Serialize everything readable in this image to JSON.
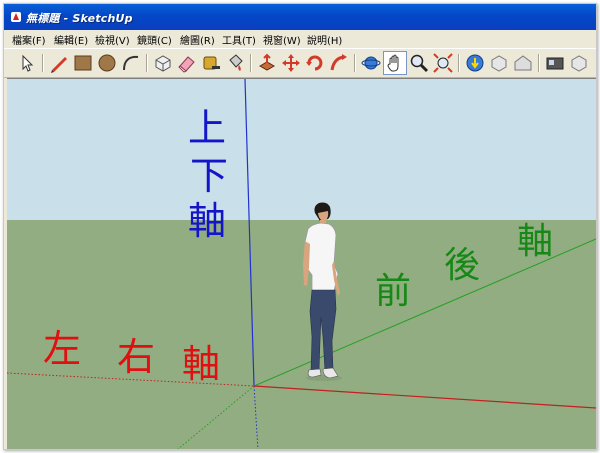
{
  "window": {
    "title": "無標題 - SketchUp"
  },
  "menu": {
    "items": [
      "檔案(F)",
      "編輯(E)",
      "檢視(V)",
      "鏡頭(C)",
      "繪圖(R)",
      "工具(T)",
      "視窗(W)",
      "說明(H)"
    ]
  },
  "toolbar": {
    "icons": [
      "select-icon",
      "pencil-icon",
      "rectangle-icon",
      "circle-icon",
      "arc-icon",
      "make-component-icon",
      "eraser-icon",
      "tape-measure-icon",
      "paint-bucket-icon",
      "push-pull-icon",
      "move-icon",
      "rotate-icon",
      "follow-me-icon",
      "orbit-icon",
      "pan-icon",
      "zoom-icon",
      "zoom-extents-icon",
      "get-models-icon",
      "share-model-icon",
      "warehouse-icon",
      "ruby-icon",
      "component-icon"
    ]
  },
  "viewport": {
    "sky_color": "#c9dfe9",
    "ground_color": "#93ad82",
    "labels": {
      "vertical_axis": [
        "上",
        "下",
        "軸"
      ],
      "depth_axis": [
        "前",
        "後",
        "軸"
      ],
      "horizontal_axis": [
        "左",
        "右",
        "軸"
      ]
    },
    "axis_colors": {
      "red": "#c02020",
      "green": "#22a022",
      "blue": "#2233cc"
    }
  }
}
